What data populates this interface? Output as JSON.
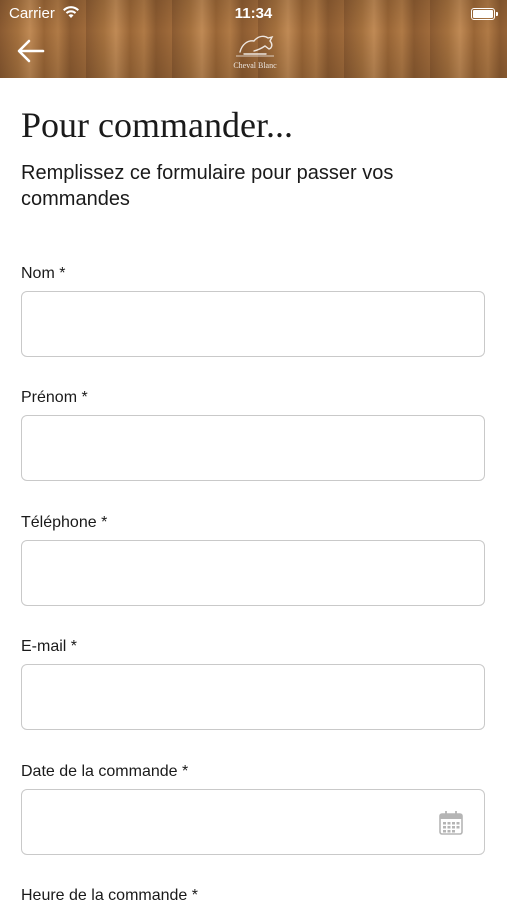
{
  "status_bar": {
    "carrier": "Carrier",
    "time": "11:34"
  },
  "header": {
    "logo_text": "Cheval Blanc",
    "back_icon": "arrow-left-icon"
  },
  "page": {
    "title": "Pour commander...",
    "subtitle": "Remplissez ce formulaire pour passer vos commandes"
  },
  "form": {
    "fields": [
      {
        "label": "Nom *",
        "value": ""
      },
      {
        "label": "Prénom *",
        "value": ""
      },
      {
        "label": "Téléphone *",
        "value": ""
      },
      {
        "label": "E-mail *",
        "value": ""
      },
      {
        "label": "Date de la commande *",
        "value": "",
        "icon": "calendar-icon"
      },
      {
        "label": "Heure de la commande *",
        "value": ""
      }
    ]
  }
}
